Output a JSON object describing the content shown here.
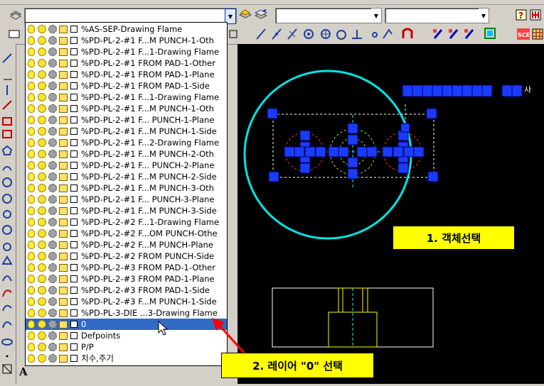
{
  "toolbar": {
    "layer_combo_value": "",
    "combo2_value": "",
    "combo3_value": ""
  },
  "layers": [
    {
      "name": "%AS-SEP-Drawing Flame"
    },
    {
      "name": "%PD-PL-2-#1 F...M PUNCH-1-Oth"
    },
    {
      "name": "%PD-PL-2-#1 F...1-Drawing Flame"
    },
    {
      "name": "%PD-PL-2-#1 FROM PAD-1-Other"
    },
    {
      "name": "%PD-PL-2-#1 FROM PAD-1-Plane"
    },
    {
      "name": "%PD-PL-2-#1 FROM PAD-1-Side"
    },
    {
      "name": "%PD-PL-2-#1 F...1-Drawing Flame"
    },
    {
      "name": "%PD-PL-2-#1 F...M PUNCH-1-Oth"
    },
    {
      "name": "%PD-PL-2-#1 F... PUNCH-1-Plane"
    },
    {
      "name": "%PD-PL-2-#1 F...M PUNCH-1-Side"
    },
    {
      "name": "%PD-PL-2-#1 F...2-Drawing Flame"
    },
    {
      "name": "%PD-PL-2-#1 F...M PUNCH-2-Oth"
    },
    {
      "name": "%PD-PL-2-#1 F... PUNCH-2-Plane"
    },
    {
      "name": "%PD-PL-2-#1 F...M PUNCH-2-Side"
    },
    {
      "name": "%PD-PL-2-#1 F...M PUNCH-3-Oth"
    },
    {
      "name": "%PD-PL-2-#1 F... PUNCH-3-Plane"
    },
    {
      "name": "%PD-PL-2-#1 F...M PUNCH-3-Side"
    },
    {
      "name": "%PD-PL-2-#2 F...1-Drawing Flame"
    },
    {
      "name": "%PD-PL-2-#2 F...OM PUNCH-Othe"
    },
    {
      "name": "%PD-PL-2-#2 F...M PUNCH-Plane"
    },
    {
      "name": "%PD-PL-2-#2 FROM PUNCH-Side"
    },
    {
      "name": "%PD-PL-2-#3 FROM PAD-1-Other"
    },
    {
      "name": "%PD-PL-2-#3 FROM PAD-1-Plane"
    },
    {
      "name": "%PD-PL-2-#3 FROM PAD-1-Side"
    },
    {
      "name": "%PD-PL-2-#3 F...M PUNCH-1-Side"
    },
    {
      "name": "%PD-PL-3-DIE ...3-Drawing Flame"
    },
    {
      "name": "0",
      "selected": true
    },
    {
      "name": "Defpoints"
    },
    {
      "name": "P/P"
    },
    {
      "name": "치수,주기"
    }
  ],
  "callouts": {
    "select_object": "1. 객체선택",
    "select_layer": "2. 레이어 \"0\" 선택"
  },
  "canvas_text": {
    "top_right_label": "사"
  },
  "colors": {
    "canvas_bg": "#000000",
    "selection_highlight": "#316ac5",
    "callout_bg": "#ffff00",
    "circle_annotation": "#00e5e5",
    "grip_blue": "#1a3cff",
    "arrow_red": "#ff0000"
  }
}
